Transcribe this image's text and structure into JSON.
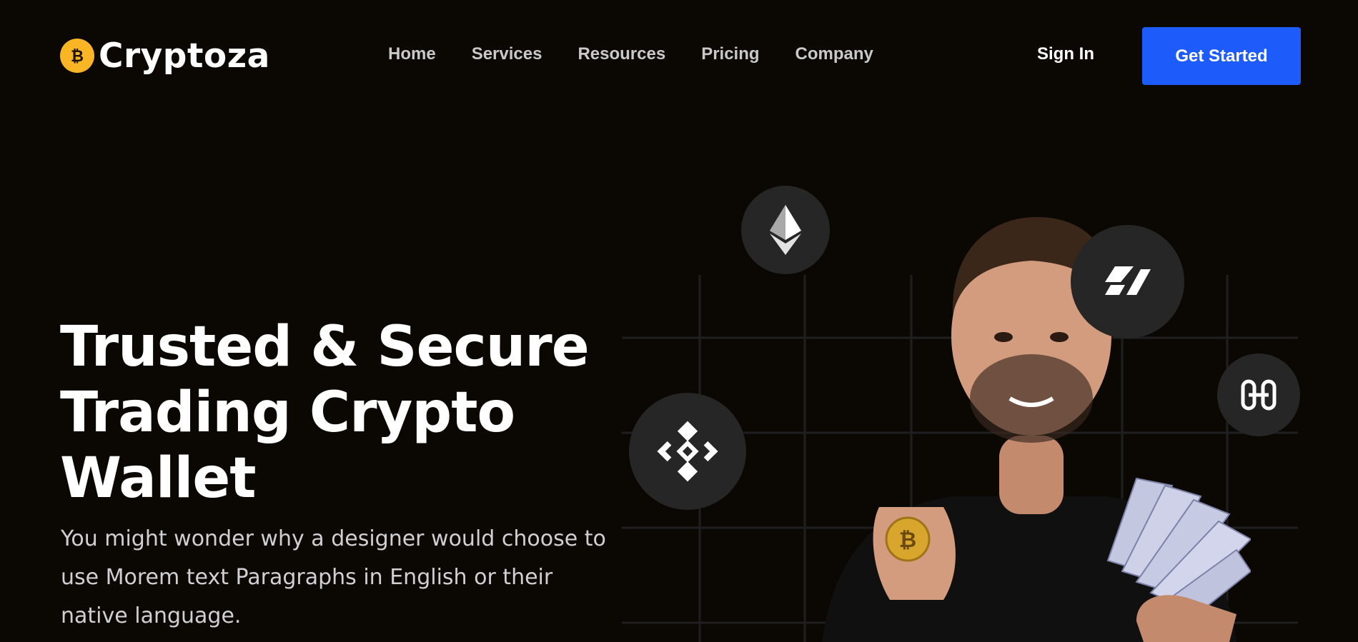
{
  "brand": {
    "name": "Cryptoza",
    "logo_icon": "bitcoin-icon",
    "accent": "#f9b524"
  },
  "nav": {
    "items": [
      {
        "label": "Home"
      },
      {
        "label": "Services"
      },
      {
        "label": "Resources"
      },
      {
        "label": "Pricing"
      },
      {
        "label": "Company"
      }
    ],
    "sign_in": "Sign In",
    "cta": "Get Started",
    "cta_color": "#1d5bfa"
  },
  "hero": {
    "title_lines": [
      "Trusted & Secure",
      "Trading Crypto",
      "Wallet"
    ],
    "paragraph": "You might wonder why a designer would choose to use Morem text Paragraphs in English or their native language."
  },
  "visual": {
    "coins": [
      {
        "icon": "ethereum-icon"
      },
      {
        "icon": "hive-icon"
      },
      {
        "icon": "harmony-icon"
      },
      {
        "icon": "binance-icon"
      }
    ],
    "photo": "man-holding-bitcoin-and-cash-image"
  },
  "colors": {
    "background": "#0b0804",
    "text": "#ffffff",
    "muted": "#d0cfd3"
  }
}
